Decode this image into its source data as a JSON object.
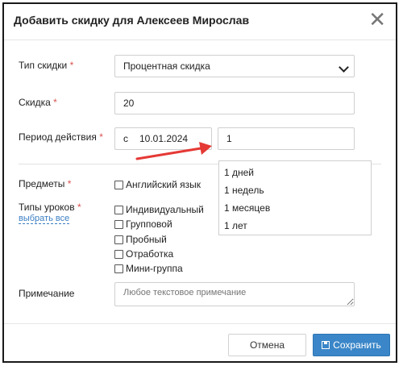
{
  "dialog": {
    "title": "Добавить скидку для Алексеев Мирослав",
    "close_glyph": "✕"
  },
  "form": {
    "discount_type_label": "Тип скидки",
    "discount_type_value": "Процентная скидка",
    "discount_label": "Скидка",
    "discount_value": "20",
    "period_label": "Период действия",
    "period_from_prefix": "с",
    "period_from_date": "10.01.2024",
    "period_duration_value": "1",
    "subjects_label": "Предметы",
    "subjects_option": "Английский язык",
    "lesson_types_label": "Типы уроков",
    "select_all_link": "выбрать все",
    "lesson_types": [
      "Индивидуальный",
      "Групповой",
      "Пробный",
      "Отработка",
      "Мини-группа"
    ],
    "note_label": "Примечание",
    "note_placeholder": "Любое текстовое примечание",
    "required_mark": "*"
  },
  "dropdown": {
    "options": [
      "1 дней",
      "1 недель",
      "1 месяцев",
      "1 лет"
    ]
  },
  "footer": {
    "cancel_label": "Отмена",
    "save_label": "Сохранить"
  },
  "colors": {
    "accent": "#3a86c8",
    "required": "#d9534f",
    "annotation_arrow": "#e53935"
  }
}
